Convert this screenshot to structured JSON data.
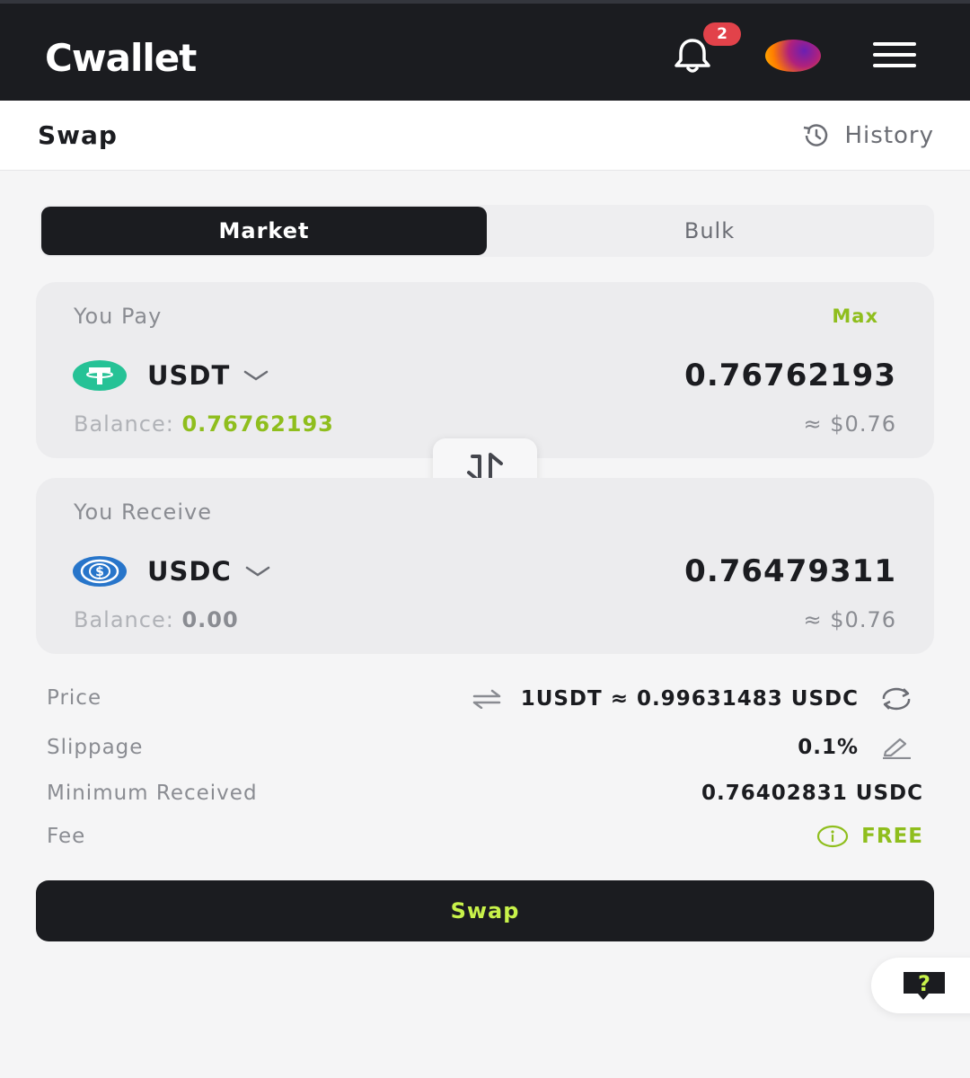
{
  "app": {
    "logo": "Cwallet",
    "notification_count": "2"
  },
  "subheader": {
    "title": "Swap",
    "history_label": "History"
  },
  "tabs": [
    {
      "label": "Market",
      "active": true
    },
    {
      "label": "Bulk",
      "active": false
    }
  ],
  "pay": {
    "label": "You Pay",
    "max_label": "Max",
    "token": "USDT",
    "amount": "0.76762193",
    "balance_label": "Balance:",
    "balance_value": "0.76762193",
    "usd_value": "≈ $0.76"
  },
  "receive": {
    "label": "You Receive",
    "token": "USDC",
    "amount": "0.76479311",
    "balance_label": "Balance:",
    "balance_value": "0.00",
    "usd_value": "≈ $0.76"
  },
  "details": {
    "price_label": "Price",
    "price_value": "1USDT ≈ 0.99631483 USDC",
    "slippage_label": "Slippage",
    "slippage_value": "0.1%",
    "min_received_label": "Minimum Received",
    "min_received_value": "0.76402831 USDC",
    "fee_label": "Fee",
    "fee_value": "FREE"
  },
  "actions": {
    "swap_label": "Swap"
  },
  "colors": {
    "accent_green": "#8fbe1d",
    "dark": "#1b1c20",
    "button_text": "#c8f24a",
    "badge_red": "#e2424a",
    "usdt": "#26c296",
    "usdc": "#2775ca"
  },
  "icons": [
    "bell-icon",
    "menu-icon",
    "history-icon",
    "usdt-icon",
    "usdc-icon",
    "chevron-down-icon",
    "swap-direction-icon",
    "exchange-arrows-icon",
    "refresh-icon",
    "edit-icon",
    "info-icon",
    "help-icon"
  ]
}
